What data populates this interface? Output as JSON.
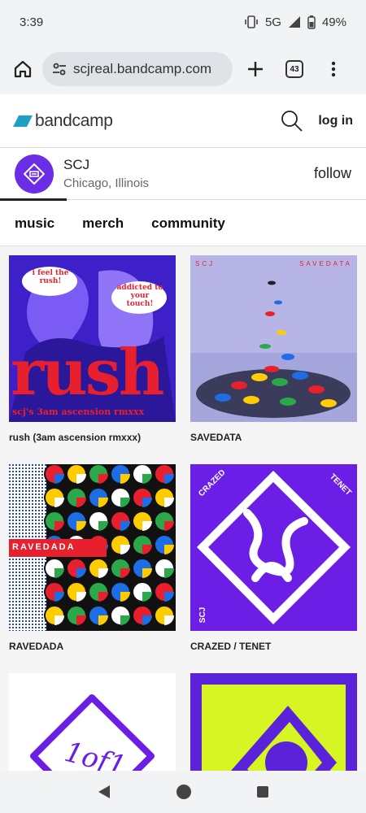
{
  "status": {
    "time": "3:39",
    "network": "5G",
    "battery": "49%"
  },
  "browser": {
    "url": "scjreal.bandcamp.com",
    "tab_count": "43"
  },
  "header": {
    "logo_text": "bandcamp",
    "login_label": "log in"
  },
  "artist": {
    "name": "SCJ",
    "location": "Chicago, Illinois",
    "follow_label": "follow"
  },
  "tabs": [
    {
      "label": "music"
    },
    {
      "label": "merch"
    },
    {
      "label": "community"
    }
  ],
  "albums": [
    {
      "title": "rush (3am ascension rmxxx)",
      "cover_text": "rush",
      "cover_sub": "scj's 3am ascension rmxxx",
      "bubble_1": "i feel the rush!",
      "bubble_2": "addicted to your touch!"
    },
    {
      "title": "SAVEDATA",
      "cover_text_left": "SCJ",
      "cover_text_right": "SAVEDATA"
    },
    {
      "title": "RAVEDADA",
      "cover_text": "RAVEDADA"
    },
    {
      "title": "CRAZED / TENET",
      "cover_text_left": "CRAZED",
      "cover_text_right": "TENET",
      "cover_text_bottom": "SCJ"
    },
    {
      "title": "",
      "cover_text": "1of1"
    },
    {
      "title": ""
    }
  ],
  "colors": {
    "bandcamp_blue": "#1da0c3",
    "purple": "#6b2ee6",
    "red": "#e8202e",
    "lime": "#d7f523"
  }
}
